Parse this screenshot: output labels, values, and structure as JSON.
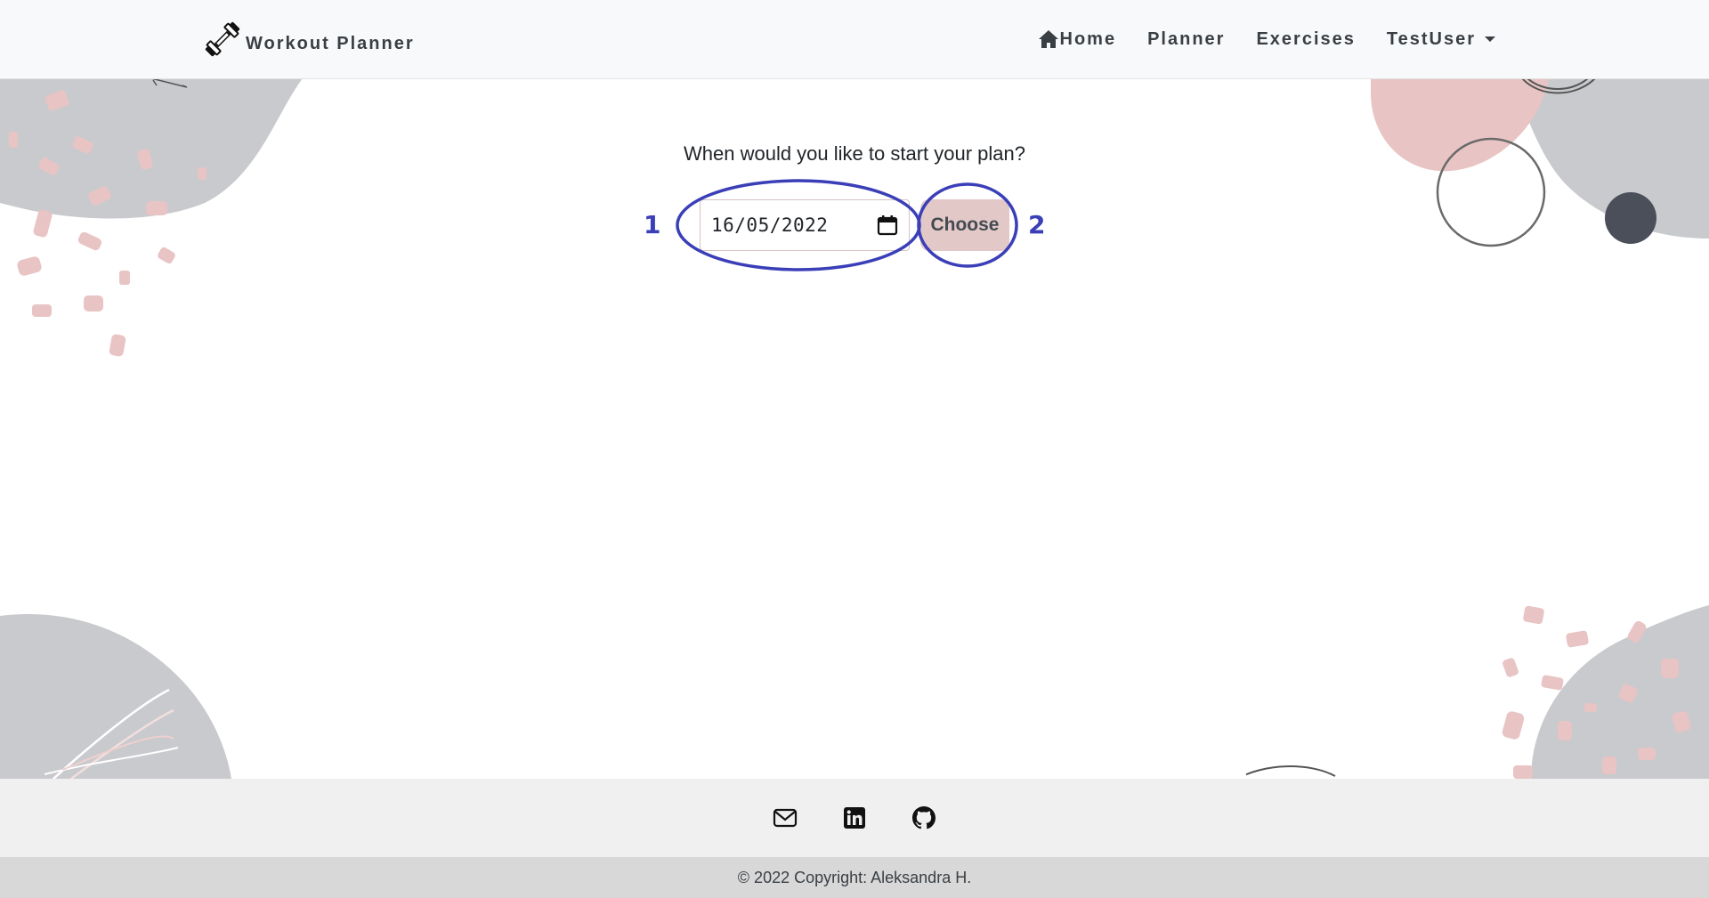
{
  "navbar": {
    "brand_label": "Workout Planner",
    "brand_icon": "dumbbell-icon",
    "links": {
      "home": "Home",
      "planner": "Planner",
      "exercises": "Exercises",
      "user": "TestUser"
    }
  },
  "main": {
    "question": "When would you like to start your plan?",
    "date_value": "16/05/2022",
    "choose_label": "Choose"
  },
  "annotations": {
    "marker_1": "1",
    "marker_2": "2",
    "color": "#3a3fb8"
  },
  "footer": {
    "icons": [
      "envelope-icon",
      "linkedin-icon",
      "github-icon"
    ],
    "copyright": "© 2022 Copyright: Aleksandra H."
  },
  "colors": {
    "navbar_bg": "#f8f9fa",
    "button_bg": "#e3c8c8",
    "footer_bg": "#f0f0f0",
    "copyright_bg": "#d8d8d8",
    "blob_gray": "#c9cacd",
    "blob_pink": "#e8c4c4"
  }
}
